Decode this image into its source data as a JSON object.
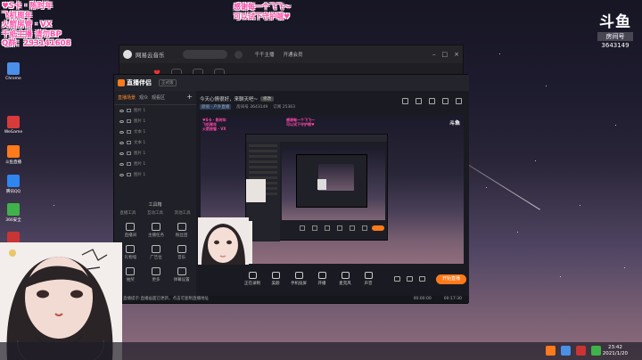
{
  "overlay": {
    "left_lines": [
      "♥S卡 · 陈时年",
      "飞机周年",
      "火箭房管 · VX",
      "千纸主播 请勿BP",
      "Q群：293141608"
    ],
    "top_lines": [
      "感谢每一个飞飞～",
      "可以试下守护哦♥"
    ]
  },
  "douyu_logo": {
    "brand": "斗鱼",
    "room_label": "房间号",
    "room_id": "3643149"
  },
  "desktop": {
    "icons": [
      {
        "label": "Chrome",
        "color": "#4a8fe8"
      },
      {
        "label": "WeGame",
        "color": "#d93a3a"
      },
      {
        "label": "斗鱼直播",
        "color": "#ff7a1a"
      },
      {
        "label": "腾讯QQ",
        "color": "#2f86f0"
      },
      {
        "label": "360安全",
        "color": "#3fb24a"
      },
      {
        "label": "网易云",
        "color": "#c93434"
      }
    ]
  },
  "taskbar": {
    "apps": [
      {
        "color": "#ff7a1a"
      },
      {
        "color": "#4a8fe8"
      },
      {
        "color": "#c93434"
      },
      {
        "color": "#3fb24a"
      }
    ],
    "time": "23:42",
    "date": "2021/1/20"
  },
  "netease": {
    "title": "网易云音乐",
    "user": "千千主播",
    "vip": "开通会员"
  },
  "live": {
    "app_name": "直播伴侣",
    "version": "正式版",
    "tabs": [
      "直播场景",
      "观众",
      "观看区"
    ],
    "scenes": [
      "图片 1",
      "图片 1",
      "文本 1",
      "文本 1",
      "图片 1",
      "图片 1",
      "图片 1"
    ],
    "tools_title": "工具箱",
    "tools_sub": [
      "直播工具",
      "互动工具",
      "其他工具"
    ],
    "tools": [
      "直播间",
      "主播任务",
      "粉丝团",
      "礼物墙",
      "广告位",
      "音乐",
      "抽奖",
      "更多",
      "弹幕设置"
    ],
    "stream_title": "今天心情很好，来聊天吧~",
    "edit_label": "修改",
    "category": "颜值 · 户外直播",
    "room_label": "房间号 3643149",
    "followers": "订阅 25363",
    "controls": [
      "正在录制",
      "美颜",
      "手机投屏",
      "开播",
      "麦克风",
      "声音"
    ],
    "go_live": "开始直播",
    "status_left": "直播提示:直播画面已更新，点击可复制直播地址",
    "status_right": [
      "00:00:00",
      "00:17:30"
    ]
  },
  "preview": {
    "pink_lines": [
      "♥S卡 · 陈时年",
      "飞机周年",
      "火箭房管 · VX"
    ],
    "top_lines": [
      "感谢每一个飞飞～",
      "可以试下守护哦♥"
    ],
    "logo": "斗鱼"
  }
}
